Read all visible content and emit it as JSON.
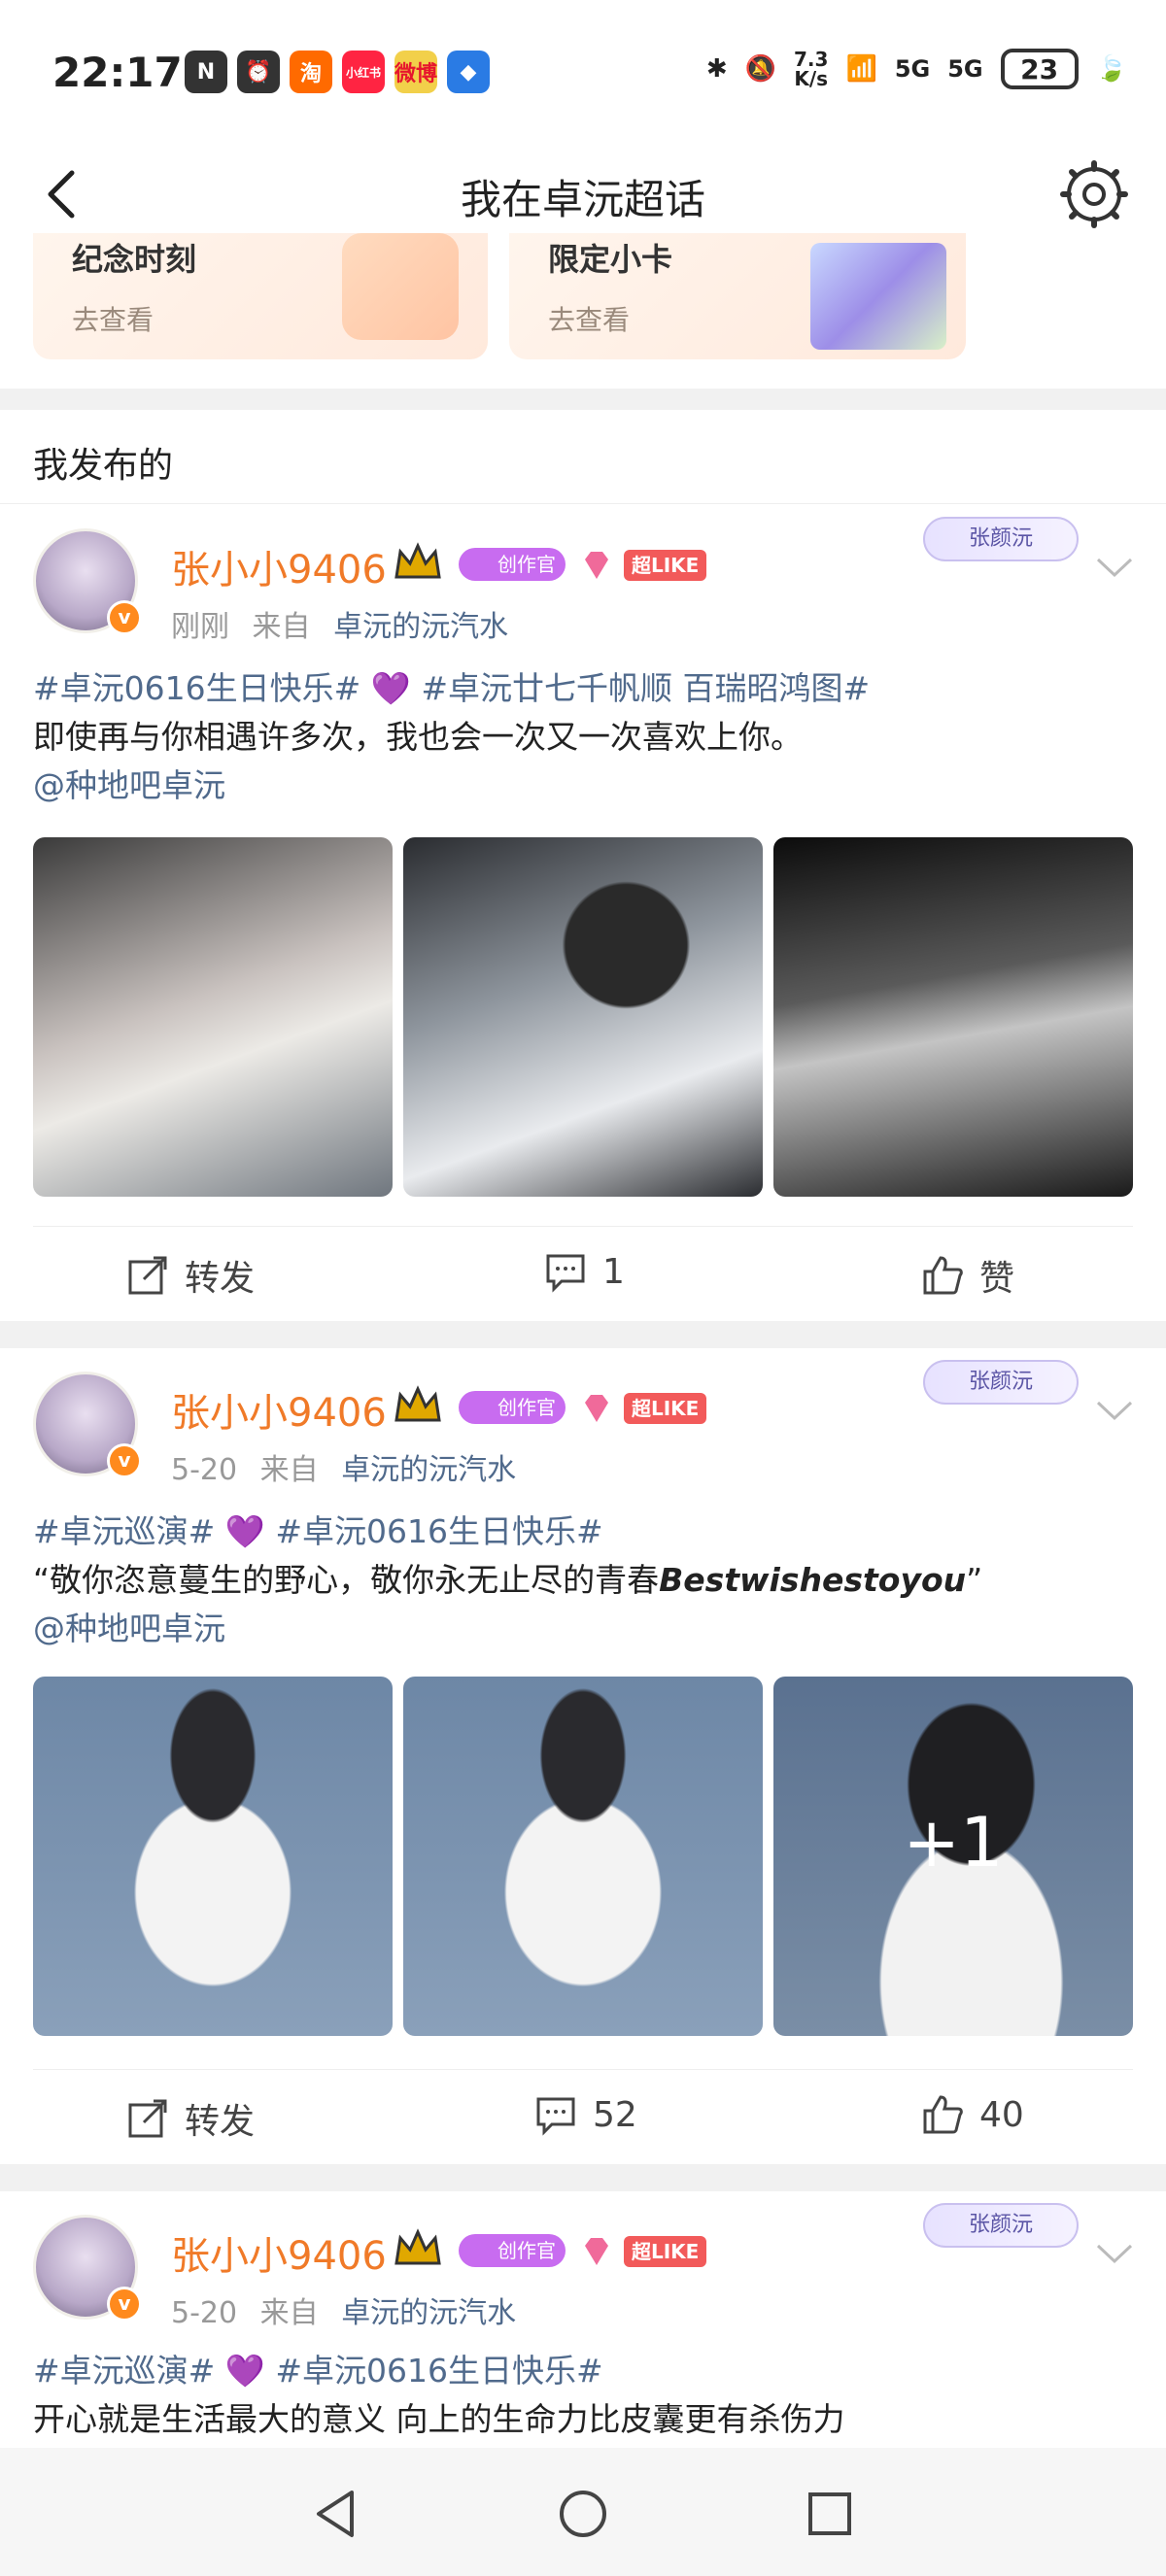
{
  "status": {
    "time": "22:17",
    "net_speed_top": "7.3",
    "net_speed_bottom": "K/s",
    "sig1": "5G",
    "sig2": "5G",
    "battery": "23",
    "app_icons": [
      "N",
      "⏰",
      "淘",
      "小红书",
      "微博",
      "😊",
      "◆"
    ]
  },
  "nav": {
    "title": "我在卓沅超话"
  },
  "cards": [
    {
      "title": "纪念时刻",
      "sub": "去查看"
    },
    {
      "title": "限定小卡",
      "sub": "去查看"
    }
  ],
  "section_title": "我发布的",
  "posts": [
    {
      "user": "张小小9406",
      "creator_badge": "创作官",
      "like_badge": "超LIKE",
      "signature": "张颜沅",
      "time": "刚刚",
      "from_label": "来自",
      "source": "卓沅的沅汽水",
      "line1_tag1": "#卓沅0616生日快乐#",
      "line1_tag2": "#卓沅廿七千帆顺 百瑞昭鸿图#",
      "line2": "即使再与你相遇许多次，我也会一次又一次喜欢上你。",
      "mention": "@种地吧卓沅",
      "repost_label": "转发",
      "comment_count": "1",
      "like_label": "赞",
      "extra_images": ""
    },
    {
      "user": "张小小9406",
      "creator_badge": "创作官",
      "like_badge": "超LIKE",
      "signature": "张颜沅",
      "time": "5-20",
      "from_label": "来自",
      "source": "卓沅的沅汽水",
      "line1_tag1": "#卓沅巡演#",
      "line1_tag2": "#卓沅0616生日快乐#",
      "line2_prefix": "“敬你恣意蔓生的野心，敬你永无止尽的青春",
      "line2_bold": "Bestwishestoyou",
      "line2_suffix": "”",
      "mention": "@种地吧卓沅",
      "repost_label": "转发",
      "comment_count": "52",
      "like_count": "40",
      "extra_images": "+1"
    },
    {
      "user": "张小小9406",
      "creator_badge": "创作官",
      "like_badge": "超LIKE",
      "signature": "张颜沅",
      "time": "5-20",
      "from_label": "来自",
      "source": "卓沅的沅汽水",
      "line1_tag1": "#卓沅巡演#",
      "line1_tag2": "#卓沅0616生日快乐#",
      "line2": "开心就是生活最大的意义 向上的生命力比皮囊更有杀伤力"
    }
  ],
  "colors": {
    "username": "#f07a28",
    "tag": "#506a8c",
    "heart": "#9b4dd4"
  }
}
